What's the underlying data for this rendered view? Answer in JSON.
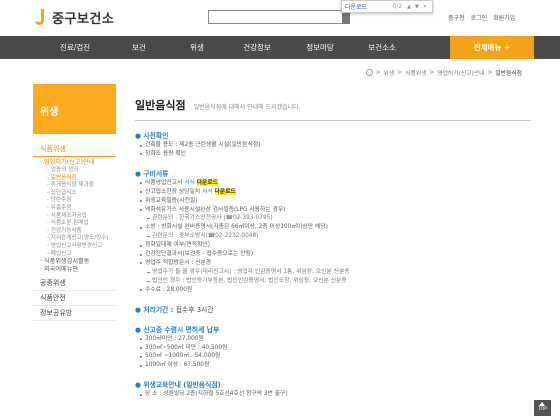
{
  "header": {
    "logo_text": "중구보건소",
    "util_links": [
      "중구청",
      "로그인",
      "회원가입"
    ]
  },
  "findbar": {
    "query": "다운로드",
    "count": "0/2"
  },
  "nav": {
    "items": [
      "진료/검진",
      "보건",
      "위생",
      "건강정보",
      "정보마당",
      "보건소소"
    ],
    "all_menu": "전체메뉴 +"
  },
  "breadcrumb": [
    "위생",
    "식품위생",
    "영업허가(신고)안내",
    "일반음식점"
  ],
  "sidebar": {
    "title": "위생",
    "categories": [
      {
        "label": "식품위생",
        "active": true,
        "sub": [
          {
            "label": "· 영업허가(신고)안내",
            "on": true,
            "children": [
              {
                "label": "- 업종의 정의",
                "on": false
              },
              {
                "label": "- 일반음식점",
                "on": true
              },
              {
                "label": "- 휴게음식점 제과점",
                "on": false
              },
              {
                "label": "- 집단급식소",
                "on": false
              },
              {
                "label": "- 단란주점",
                "on": false
              },
              {
                "label": "- 유흥주점",
                "on": false
              },
              {
                "label": "- 식품제조가공업",
                "on": false
              },
              {
                "label": "- 식품소분.판매업",
                "on": false
              },
              {
                "label": "- 건강기능식품",
                "on": false
              },
              {
                "label": "- 지위승계신고(양도/양수)",
                "on": false
              },
              {
                "label": "- 영업신고사항변경신고",
                "on": false
              },
              {
                "label": "- 폐업신고",
                "on": false
              }
            ]
          },
          {
            "label": "· 식품위생감시활동",
            "on": false,
            "children": []
          },
          {
            "label": "· 외국어메뉴판",
            "on": false,
            "children": []
          }
        ]
      },
      {
        "label": "공중위생",
        "active": false,
        "sub": []
      },
      {
        "label": "식품안전",
        "active": false,
        "sub": []
      },
      {
        "label": "정보공유방",
        "active": false,
        "sub": []
      }
    ]
  },
  "content": {
    "title": "일반음식점",
    "subtitle": "일반음식점에 대해서 안내해 드리겠습니다.",
    "sections": [
      {
        "heading": "사전확인",
        "value": "",
        "items": [
          {
            "text": "건축물 용도 : 제2종 근린생활 시설(일반음식점)",
            "sub": false
          },
          {
            "text": "정화조 용량 확인",
            "sub": false
          }
        ]
      },
      {
        "heading": "구비서류",
        "value": "",
        "items": [
          {
            "text": "식품영업신고서 ",
            "dl": "서식",
            "hl": "다운로드",
            "sub": false
          },
          {
            "text": "신고업소현장 상당일치 ",
            "dl": "서식",
            "hl": "다운로드",
            "sub": false
          },
          {
            "text": "위생교육필증(사전필)",
            "sub": false
          },
          {
            "text": "액화석유가스 사용시설완성 검사필증(LPG 사용하는 경우)",
            "sub": false
          },
          {
            "text": "관련문의 : 한국가스안전공사 (☎02-393-0795)",
            "sub": true
          },
          {
            "text": "소방 · 방화시설 완비증명서(지층은 66㎡이상, 2층 이상100㎡이상만 해당)",
            "sub": false
          },
          {
            "text": "관련문의 : 중부소방서(☎02-2232-0048)",
            "sub": true
          },
          {
            "text": "정화일대제 여부(면적확인)",
            "sub": false
          },
          {
            "text": "건강진단결과서(보건증 - 접수증으로는 안됨)",
            "sub": false
          },
          {
            "text": "영업주 적합방문서 : 신분증",
            "sub": false
          },
          {
            "text": "영업주가 둘 을 경우(대리신고시) : 영업자 인감증명서 1통, 위임장, 오신분 신분증",
            "sub": true
          },
          {
            "text": "법인인 경우 : 법인등기부등본, 법인인감증명서, 법인도장, 위임장, 오신분 신분증",
            "sub": true
          },
          {
            "text": "수수료 : 28,000원",
            "sub": false
          }
        ]
      },
      {
        "heading": "처리기간 : ",
        "value": "접수후 3시간",
        "items": []
      },
      {
        "heading": "신고증 수령시 면허세 납부",
        "value": "",
        "items": [
          {
            "text": "300㎡미만 : 27,000원",
            "sub": false
          },
          {
            "text": "300㎡~500㎡ 미만 : 40,500원",
            "sub": false
          },
          {
            "text": "500㎡ ~1000㎡ : 54,000원",
            "sub": false
          },
          {
            "text": "1000㎡ 이상 : 67,500원",
            "sub": false
          }
        ]
      },
      {
        "heading": "위생교육안내 (일반음식점)",
        "value": "",
        "items": [
          {
            "text": "장 소 : 성원빌딩 2층(지하철 5호선4호선 청구역 3번 출구)",
            "sub": false
          }
        ]
      }
    ]
  },
  "top_button": "TOP"
}
